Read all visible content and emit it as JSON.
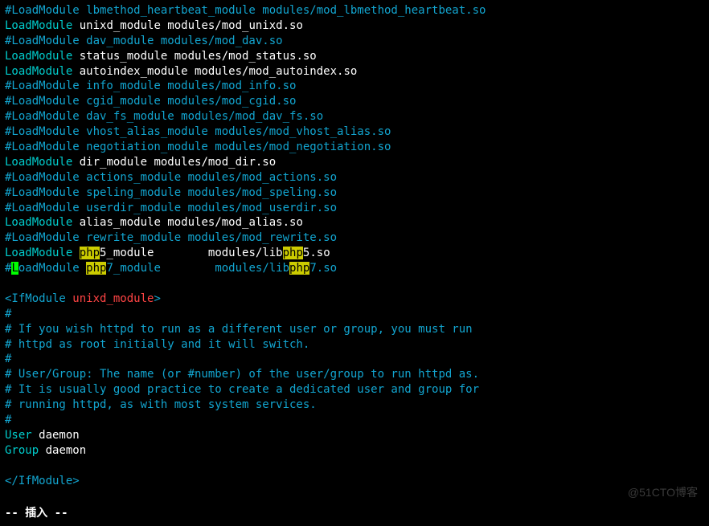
{
  "lines": [
    {
      "type": "comment",
      "text": "#LoadModule lbmethod_heartbeat_module modules/mod_lbmethod_heartbeat.so"
    },
    {
      "type": "active",
      "kw": "LoadModule",
      "rest": " unixd_module modules/mod_unixd.so"
    },
    {
      "type": "comment",
      "text": "#LoadModule dav_module modules/mod_dav.so"
    },
    {
      "type": "active",
      "kw": "LoadModule",
      "rest": " status_module modules/mod_status.so"
    },
    {
      "type": "active",
      "kw": "LoadModule",
      "rest": " autoindex_module modules/mod_autoindex.so"
    },
    {
      "type": "comment",
      "text": "#LoadModule info_module modules/mod_info.so"
    },
    {
      "type": "comment",
      "text": "#LoadModule cgid_module modules/mod_cgid.so"
    },
    {
      "type": "comment",
      "text": "#LoadModule dav_fs_module modules/mod_dav_fs.so"
    },
    {
      "type": "comment",
      "text": "#LoadModule vhost_alias_module modules/mod_vhost_alias.so"
    },
    {
      "type": "comment",
      "text": "#LoadModule negotiation_module modules/mod_negotiation.so"
    },
    {
      "type": "active",
      "kw": "LoadModule",
      "rest": " dir_module modules/mod_dir.so"
    },
    {
      "type": "comment",
      "text": "#LoadModule actions_module modules/mod_actions.so"
    },
    {
      "type": "comment",
      "text": "#LoadModule speling_module modules/mod_speling.so"
    },
    {
      "type": "comment",
      "text": "#LoadModule userdir_module modules/mod_userdir.so"
    },
    {
      "type": "active",
      "kw": "LoadModule",
      "rest": " alias_module modules/mod_alias.so"
    },
    {
      "type": "comment",
      "text": "#LoadModule rewrite_module modules/mod_rewrite.so"
    },
    {
      "type": "php_active",
      "kw": "LoadModule",
      "sp1": " ",
      "hl1": "php",
      "mid": "5_module        modules/lib",
      "hl2": "php",
      "end": "5.so"
    },
    {
      "type": "php_cursor",
      "hash": "#",
      "cursor": "L",
      "kw": "oadModule",
      "sp1": " ",
      "hl1": "php",
      "mid": "7_module        modules/lib",
      "hl2": "php",
      "end": "7.so"
    },
    {
      "type": "blank"
    },
    {
      "type": "ifopen",
      "open": "<IfModule ",
      "name": "unixd_module",
      "close": ">"
    },
    {
      "type": "comment",
      "text": "#"
    },
    {
      "type": "comment",
      "text": "# If you wish httpd to run as a different user or group, you must run"
    },
    {
      "type": "comment",
      "text": "# httpd as root initially and it will switch."
    },
    {
      "type": "comment",
      "text": "#"
    },
    {
      "type": "comment",
      "text": "# User/Group: The name (or #number) of the user/group to run httpd as."
    },
    {
      "type": "comment",
      "text": "# It is usually good practice to create a dedicated user and group for"
    },
    {
      "type": "comment",
      "text": "# running httpd, as with most system services."
    },
    {
      "type": "comment",
      "text": "#"
    },
    {
      "type": "active",
      "kw": "User",
      "rest": " daemon"
    },
    {
      "type": "active",
      "kw": "Group",
      "rest": " daemon"
    },
    {
      "type": "blank"
    },
    {
      "type": "ifclose",
      "text": "</IfModule>"
    },
    {
      "type": "blank"
    }
  ],
  "status": "-- 插入 --",
  "watermark": "@51CTO博客"
}
